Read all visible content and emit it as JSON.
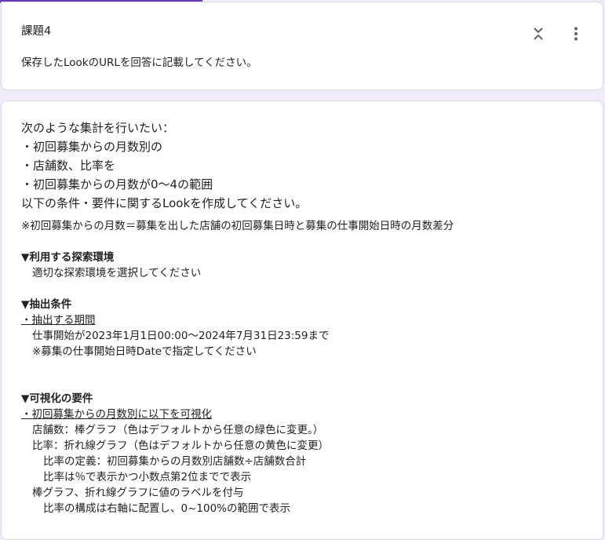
{
  "progress": {
    "fraction": 0.335,
    "color": "#673ab7"
  },
  "question": {
    "title": "課題4",
    "description": "保存したLookのURLを回答に記載してください。"
  },
  "icons": {
    "collapse": "collapse-icon",
    "more": "more-vert-icon"
  },
  "details": {
    "intro": [
      "次のような集計を行いたい：",
      "・初回募集からの月数別の",
      "・店舗数、比率を",
      "・初回募集からの月数が0〜4の範囲",
      "以下の条件・要件に関するLookを作成してください。"
    ],
    "note": "※初回募集からの月数＝募集を出した店舗の初回募集日時と募集の仕事開始日時の月数差分",
    "explore_heading": "▼利用する探索環境",
    "explore_text": "適切な探索環境を選択してください",
    "extract_heading": "▼抽出条件",
    "extract_period_label": "・抽出する期間",
    "extract_period_text": "仕事開始が2023年1月1日00:00〜2024年7月31日23:59まで",
    "extract_period_note": "※募集の仕事開始日時Dateで指定してください",
    "viz_heading": "▼可視化の要件",
    "viz_label": "・初回募集からの月数別に以下を可視化",
    "viz_store": "店舗数：棒グラフ（色はデフォルトから任意の緑色に変更。）",
    "viz_ratio": "比率：折れ線グラフ（色はデフォルトから任意の黄色に変更）",
    "viz_ratio_def": "比率の定義：初回募集からの月数別店舗数÷店舗数合計",
    "viz_ratio_format": "比率は％で表示かつ小数点第2位までで表示",
    "viz_labels": "棒グラフ、折れ線グラフに値のラベルを付与",
    "viz_axis": "比率の構成は右軸に配置し、0~100%の範囲で表示"
  }
}
